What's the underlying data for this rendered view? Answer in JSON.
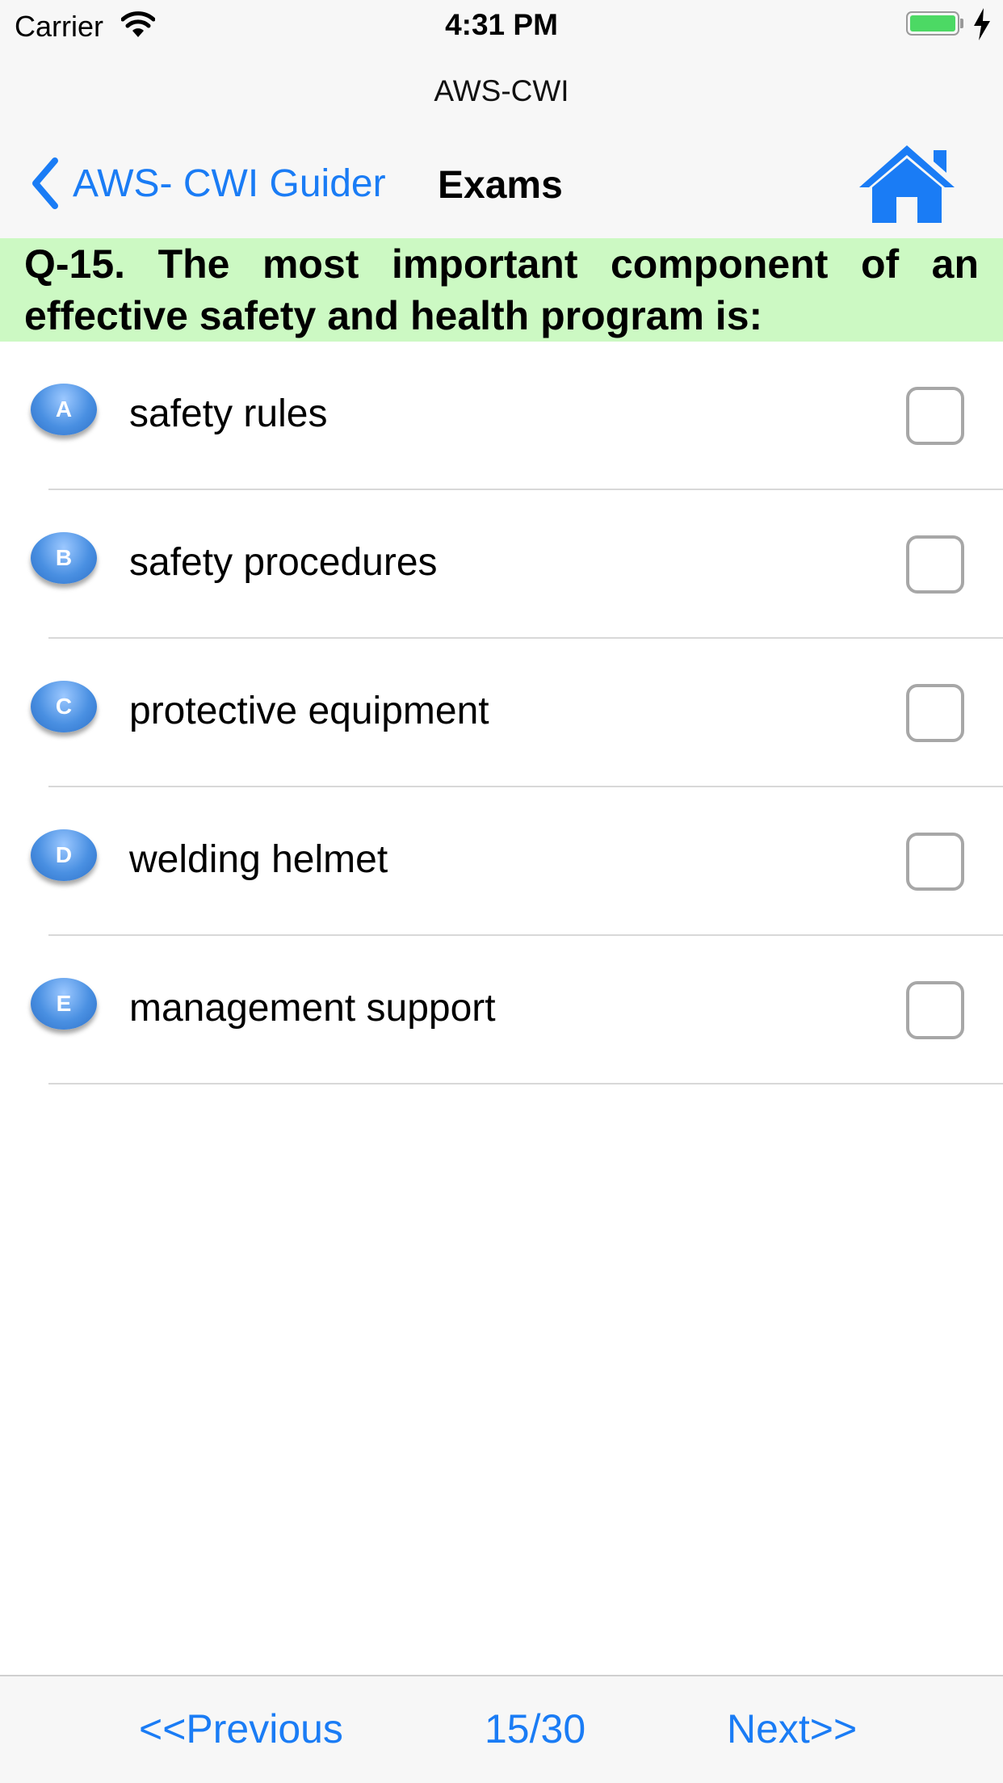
{
  "status_bar": {
    "carrier": "Carrier",
    "time": "4:31 PM",
    "battery_color": "#4cd964"
  },
  "nav": {
    "app_title": "AWS-CWI",
    "back_label": "AWS- CWI Guider",
    "page_title": "Exams",
    "home_icon": "home-icon",
    "accent_color": "#1a7cf5"
  },
  "question": {
    "text": "Q-15. The most important component of an effective safety and health program is:",
    "background_color": "#ccf9c3"
  },
  "options": [
    {
      "letter": "A",
      "text": "safety rules",
      "checked": false
    },
    {
      "letter": "B",
      "text": "safety procedures",
      "checked": false
    },
    {
      "letter": "C",
      "text": "protective equipment",
      "checked": false
    },
    {
      "letter": "D",
      "text": "welding helmet",
      "checked": false
    },
    {
      "letter": "E",
      "text": "management support",
      "checked": false
    }
  ],
  "footer": {
    "previous_label": "<<Previous",
    "page_counter": "15/30",
    "next_label": "Next>>"
  }
}
